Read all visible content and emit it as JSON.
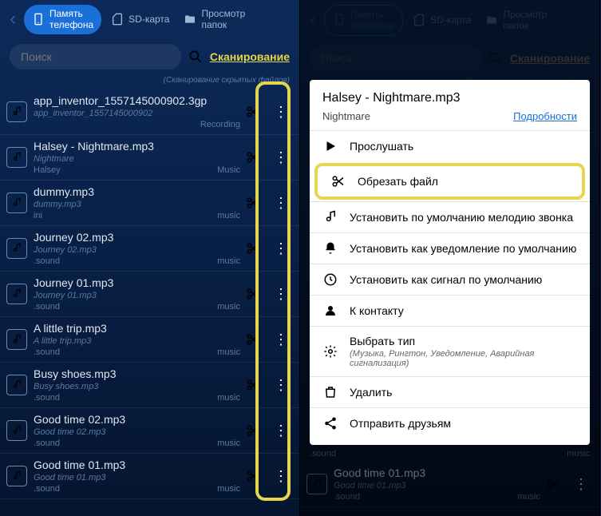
{
  "tabs": {
    "phone": "Память\nтелефона",
    "sd": "SD-карта",
    "folders": "Просмотр\nпапок"
  },
  "search": {
    "placeholder": "Поиск"
  },
  "scan": "Сканирование",
  "hint": "(Сканирование скрытых файлов)",
  "items": [
    {
      "title": "app_inventor_1557145000902.3gp",
      "sub": "app_inventor_1557145000902",
      "left": "<unknown>",
      "right": "Recording"
    },
    {
      "title": "Halsey - Nightmare.mp3",
      "sub": "Nightmare",
      "left": "Halsey",
      "right": "Music"
    },
    {
      "title": "dummy.mp3",
      "sub": "dummy.mp3",
      "left": "ini",
      "right": "music"
    },
    {
      "title": "Journey 02.mp3",
      "sub": "Journey 02.mp3",
      "left": ".sound",
      "right": "music"
    },
    {
      "title": "Journey 01.mp3",
      "sub": "Journey 01.mp3",
      "left": ".sound",
      "right": "music"
    },
    {
      "title": "A little trip.mp3",
      "sub": "A little trip.mp3",
      "left": ".sound",
      "right": "music"
    },
    {
      "title": "Busy shoes.mp3",
      "sub": "Busy shoes.mp3",
      "left": ".sound",
      "right": "music"
    },
    {
      "title": "Good time 02.mp3",
      "sub": "Good time 02.mp3",
      "left": ".sound",
      "right": "music"
    },
    {
      "title": "Good time 01.mp3",
      "sub": "Good time 01.mp3",
      "left": ".sound",
      "right": "music"
    }
  ],
  "dialog": {
    "title": "Halsey - Nightmare.mp3",
    "sub": "Nightmare",
    "details": "Подробности",
    "actions": [
      {
        "icon": "play",
        "label": "Прослушать"
      },
      {
        "icon": "cut",
        "label": "Обрезать файл",
        "hl": true
      },
      {
        "icon": "note",
        "label": "Установить по умолчанию мелодию звонка"
      },
      {
        "icon": "bell",
        "label": "Установить как уведомление по умолчанию"
      },
      {
        "icon": "clock",
        "label": "Установить как сигнал по умолчанию"
      },
      {
        "icon": "contact",
        "label": "К контакту"
      },
      {
        "icon": "gear",
        "label": "Выбрать тип",
        "sub": "(Музыка, Рингтон, Уведомление, Аварийная сигнализация)"
      },
      {
        "icon": "trash",
        "label": "Удалить"
      },
      {
        "icon": "share",
        "label": "Отправить друзьям"
      }
    ]
  },
  "bg": [
    {
      "left": ".sound",
      "right": "music",
      "title": "Good time 01.mp3",
      "sub": "Good time 01.mp3"
    }
  ]
}
